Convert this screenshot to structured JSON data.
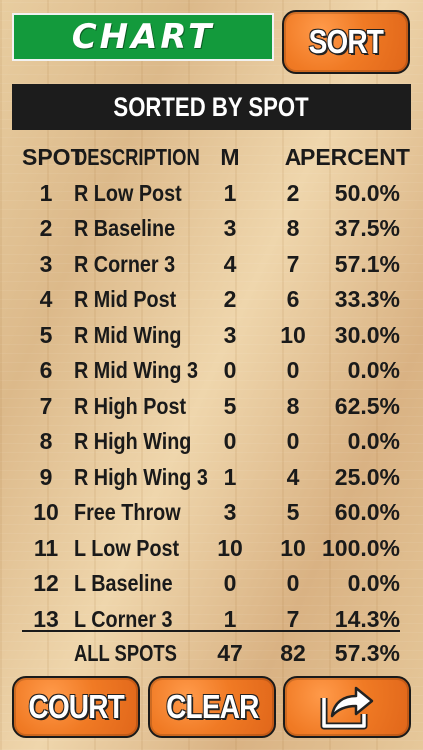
{
  "top": {
    "chart_tab": "CHART",
    "sort_button": "SORT"
  },
  "header": {
    "title": "SORTED BY SPOT"
  },
  "table": {
    "columns": [
      "SPOT",
      "DESCRIPTION",
      "M",
      "A",
      "PERCENT"
    ],
    "rows": [
      {
        "spot": "1",
        "description": "R Low Post",
        "m": "1",
        "a": "2",
        "percent": "50.0%"
      },
      {
        "spot": "2",
        "description": "R Baseline",
        "m": "3",
        "a": "8",
        "percent": "37.5%"
      },
      {
        "spot": "3",
        "description": "R Corner 3",
        "m": "4",
        "a": "7",
        "percent": "57.1%"
      },
      {
        "spot": "4",
        "description": "R Mid Post",
        "m": "2",
        "a": "6",
        "percent": "33.3%"
      },
      {
        "spot": "5",
        "description": "R Mid Wing",
        "m": "3",
        "a": "10",
        "percent": "30.0%"
      },
      {
        "spot": "6",
        "description": "R Mid Wing 3",
        "m": "0",
        "a": "0",
        "percent": "0.0%"
      },
      {
        "spot": "7",
        "description": "R High Post",
        "m": "5",
        "a": "8",
        "percent": "62.5%"
      },
      {
        "spot": "8",
        "description": "R High Wing",
        "m": "0",
        "a": "0",
        "percent": "0.0%"
      },
      {
        "spot": "9",
        "description": "R High Wing 3",
        "m": "1",
        "a": "4",
        "percent": "25.0%"
      },
      {
        "spot": "10",
        "description": "Free Throw",
        "m": "3",
        "a": "5",
        "percent": "60.0%"
      },
      {
        "spot": "11",
        "description": "L Low Post",
        "m": "10",
        "a": "10",
        "percent": "100.0%"
      },
      {
        "spot": "12",
        "description": "L Baseline",
        "m": "0",
        "a": "0",
        "percent": "0.0%"
      },
      {
        "spot": "13",
        "description": "L Corner 3",
        "m": "1",
        "a": "7",
        "percent": "14.3%"
      }
    ],
    "total": {
      "description": "ALL SPOTS",
      "m": "47",
      "a": "82",
      "percent": "57.3%"
    }
  },
  "bottom": {
    "court_button": "COURT",
    "clear_button": "CLEAR",
    "share_icon": "share-arrow-icon"
  },
  "colors": {
    "chart_tab": "#139a3c",
    "button_orange": "#f07a24",
    "header_bar": "#1c1c1c",
    "text": "#1a1a1a"
  }
}
